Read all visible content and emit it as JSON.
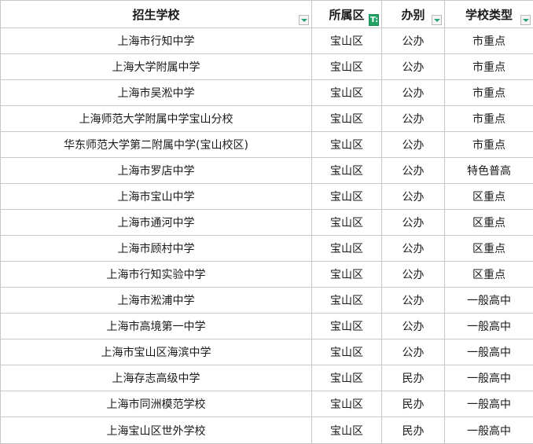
{
  "headers": [
    {
      "label": "招生学校",
      "filter": "filter-icon"
    },
    {
      "label": "所属区",
      "filter": "sorted-filter-icon",
      "filter_glyph": "T:"
    },
    {
      "label": "办别",
      "filter": "filter-icon"
    },
    {
      "label": "学校类型",
      "filter": "filter-icon"
    }
  ],
  "rows": [
    [
      "上海市行知中学",
      "宝山区",
      "公办",
      "市重点"
    ],
    [
      "上海大学附属中学",
      "宝山区",
      "公办",
      "市重点"
    ],
    [
      "上海市吴淞中学",
      "宝山区",
      "公办",
      "市重点"
    ],
    [
      "上海师范大学附属中学宝山分校",
      "宝山区",
      "公办",
      "市重点"
    ],
    [
      "华东师范大学第二附属中学(宝山校区)",
      "宝山区",
      "公办",
      "市重点"
    ],
    [
      "上海市罗店中学",
      "宝山区",
      "公办",
      "特色普高"
    ],
    [
      "上海市宝山中学",
      "宝山区",
      "公办",
      "区重点"
    ],
    [
      "上海市通河中学",
      "宝山区",
      "公办",
      "区重点"
    ],
    [
      "上海市顾村中学",
      "宝山区",
      "公办",
      "区重点"
    ],
    [
      "上海市行知实验中学",
      "宝山区",
      "公办",
      "区重点"
    ],
    [
      "上海市淞浦中学",
      "宝山区",
      "公办",
      "一般高中"
    ],
    [
      "上海市高境第一中学",
      "宝山区",
      "公办",
      "一般高中"
    ],
    [
      "上海市宝山区海滨中学",
      "宝山区",
      "公办",
      "一般高中"
    ],
    [
      "上海存志高级中学",
      "宝山区",
      "民办",
      "一般高中"
    ],
    [
      "上海市同洲模范学校",
      "宝山区",
      "民办",
      "一般高中"
    ],
    [
      "上海宝山区世外学校",
      "宝山区",
      "民办",
      "一般高中"
    ]
  ],
  "colors": {
    "grid": "#c8c8c8",
    "sorted_filter": "#21a366",
    "filter_arrow": "#2aa57a"
  }
}
